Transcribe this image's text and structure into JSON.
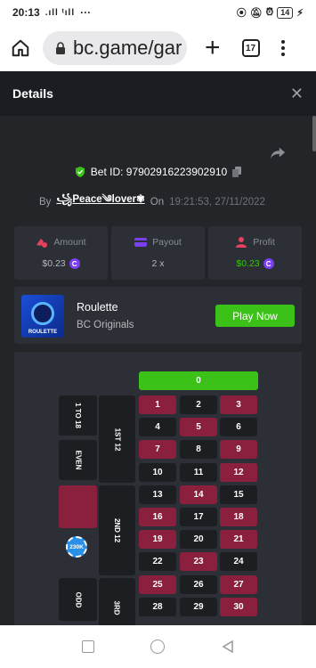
{
  "status_bar": {
    "time": "20:13",
    "signal": ".ıll ᵗıll",
    "more": "···",
    "battery": "14"
  },
  "browser": {
    "url": "bc.game/gar",
    "tab_count": "17"
  },
  "details": {
    "title": "Details",
    "bet_id": "Bet ID: 97902916223902910",
    "by_label": "By",
    "username": "꧁Peace༄lover✾",
    "on_label": "On",
    "timestamp": "19:21:53, 27/11/2022"
  },
  "stats": {
    "amount_label": "Amount",
    "amount_value": "$0.23",
    "payout_label": "Payout",
    "payout_value": "2 x",
    "profit_label": "Profit",
    "profit_value": "$0.23",
    "coin_symbol": "C"
  },
  "game": {
    "thumb_label": "ROULETTE",
    "name": "Roulette",
    "provider": "BC Originals",
    "play_label": "Play Now"
  },
  "board": {
    "zero": "0",
    "outside": {
      "one_to_18": "1 TO 18",
      "even": "EVEN",
      "odd": "ODD",
      "first12": "1ST 12",
      "second12": "2ND 12",
      "third12": "3RD"
    },
    "chip_label": "230K",
    "rows": [
      [
        "1",
        "2",
        "3"
      ],
      [
        "4",
        "5",
        "6"
      ],
      [
        "7",
        "8",
        "9"
      ],
      [
        "10",
        "11",
        "12"
      ],
      [
        "13",
        "14",
        "15"
      ],
      [
        "16",
        "17",
        "18"
      ],
      [
        "19",
        "20",
        "21"
      ],
      [
        "22",
        "23",
        "24"
      ],
      [
        "25",
        "26",
        "27"
      ],
      [
        "28",
        "29",
        "30"
      ]
    ],
    "red_numbers": [
      "1",
      "3",
      "5",
      "7",
      "9",
      "12",
      "14",
      "16",
      "18",
      "19",
      "21",
      "23",
      "25",
      "27",
      "30"
    ]
  },
  "colors": {
    "accent_green": "#3bc117",
    "red_cell": "#8a1f3e",
    "black_cell": "#1c1e22",
    "panel": "#2c2f35",
    "background": "#232529"
  }
}
